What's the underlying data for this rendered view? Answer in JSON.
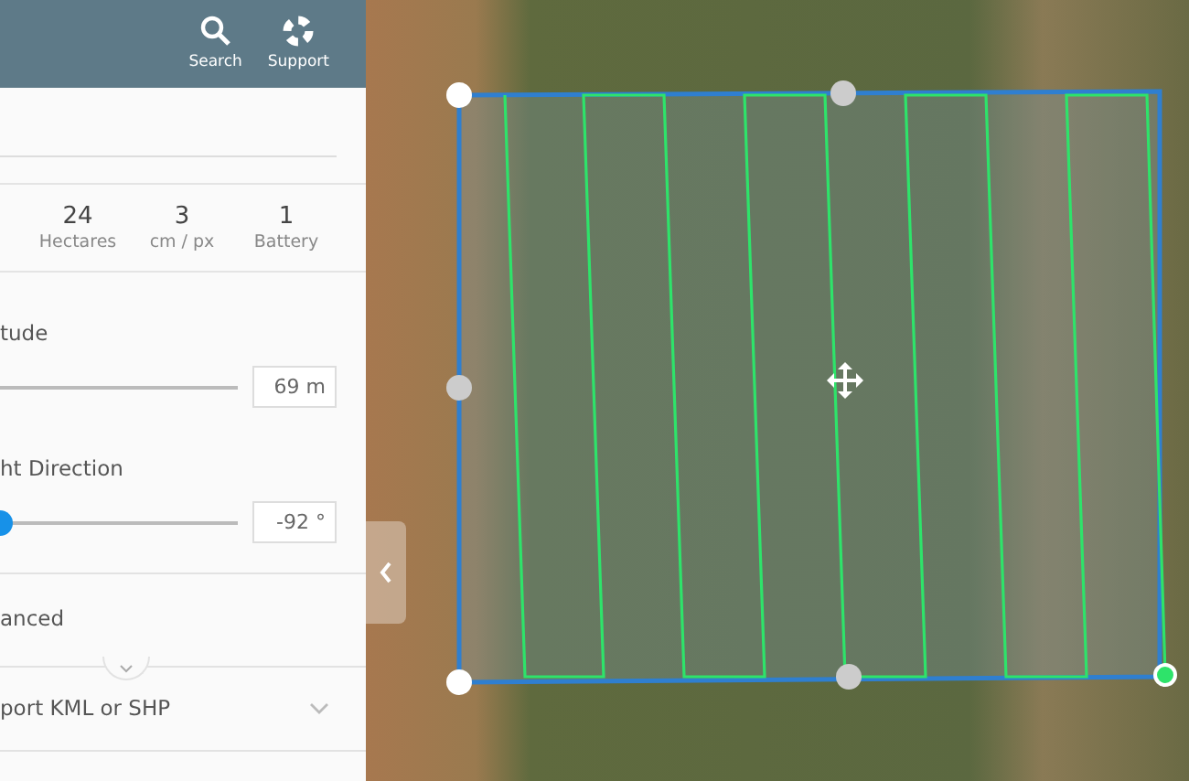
{
  "header": {
    "buttons": [
      {
        "kind": "search",
        "label": "Search"
      },
      {
        "kind": "support",
        "label": "Support"
      }
    ]
  },
  "stats": [
    {
      "value": "24",
      "label": "Hectares"
    },
    {
      "value": "3",
      "label": "cm / px"
    },
    {
      "value": "1",
      "label": "Battery"
    }
  ],
  "settings": [
    {
      "label": "tude",
      "value": "69 m"
    },
    {
      "label": "ht Direction",
      "value": "-92 °",
      "level": 0
    }
  ],
  "sections": [
    {
      "kind": "toggle",
      "label": "anced"
    },
    {
      "kind": "dropdown",
      "label": "port KML or SHP",
      "expanded": false
    }
  ]
}
